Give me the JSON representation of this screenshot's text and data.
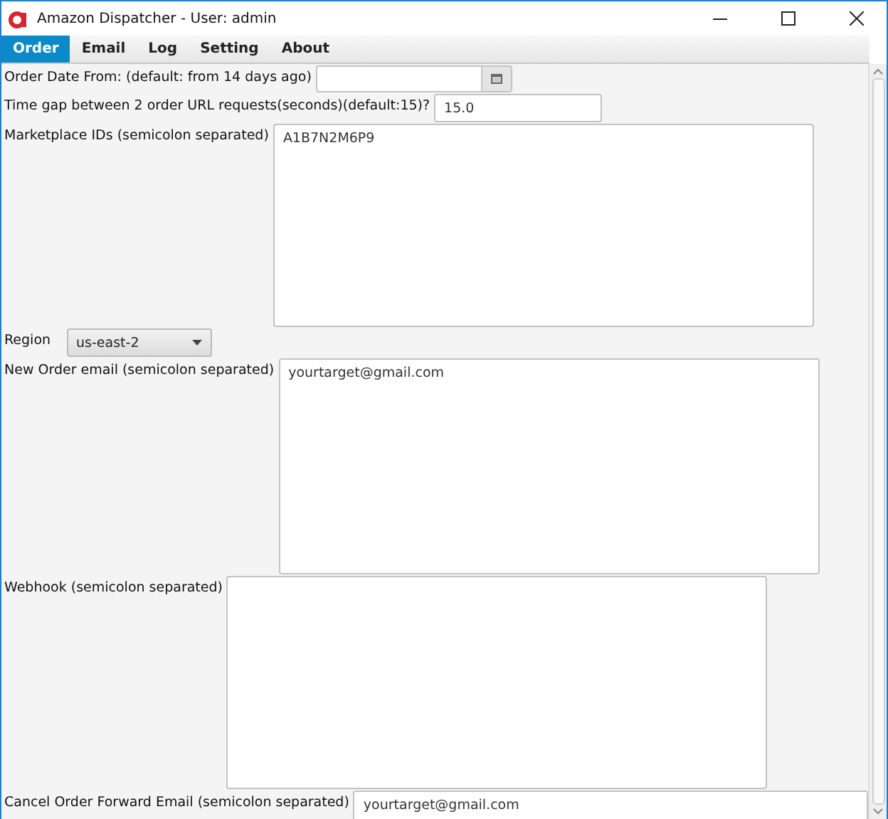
{
  "window": {
    "title": "Amazon Dispatcher - User: admin"
  },
  "tabs": [
    {
      "label": "Order",
      "selected": true
    },
    {
      "label": "Email",
      "selected": false
    },
    {
      "label": "Log",
      "selected": false
    },
    {
      "label": "Setting",
      "selected": false
    },
    {
      "label": "About",
      "selected": false
    }
  ],
  "fields": [
    {
      "kind": "date",
      "label": "Order Date From: (default: from 14 days ago)"
    },
    {
      "kind": "text",
      "label": "Time gap between 2 order URL requests(seconds)(default:15)?",
      "value": "15.0"
    },
    {
      "kind": "textarea",
      "label": "Marketplace IDs (semicolon separated)",
      "value": "A1B7N2M6P9"
    },
    {
      "kind": "select",
      "label": "Region",
      "value": "us-east-2"
    },
    {
      "kind": "textarea",
      "label": "New Order email (semicolon separated)",
      "value": "yourtarget@gmail.com"
    },
    {
      "kind": "textarea",
      "label": "Webhook (semicolon separated)"
    },
    {
      "kind": "wide",
      "label": "Cancel Order Forward Email (semicolon separated)",
      "value": "yourtarget@gmail.com"
    }
  ]
}
